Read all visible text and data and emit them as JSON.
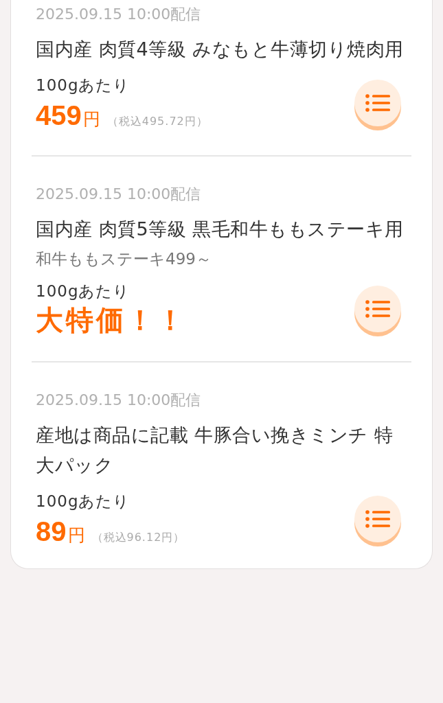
{
  "items": [
    {
      "date": "2025.09.15 10:00配信",
      "title": "国内産 肉質4等級 みなもと牛薄切り焼肉用",
      "per_unit": "100gあたり",
      "price": {
        "kind": "amount",
        "amount": "459",
        "currency": "円",
        "tax_included": "（税込495.72円）"
      }
    },
    {
      "date": "2025.09.15 10:00配信",
      "title": "国内産 肉質5等級 黒毛和牛ももステーキ用",
      "subtitle": "和牛ももステーキ499～",
      "per_unit": "100gあたり",
      "price": {
        "kind": "special",
        "text": "大特価！！"
      }
    },
    {
      "date": "2025.09.15 10:00配信",
      "title": "産地は商品に記載 牛豚合い挽きミンチ 特大パック",
      "per_unit": "100gあたり",
      "price": {
        "kind": "amount",
        "amount": "89",
        "currency": "円",
        "tax_included": "（税込96.12円）"
      }
    }
  ]
}
